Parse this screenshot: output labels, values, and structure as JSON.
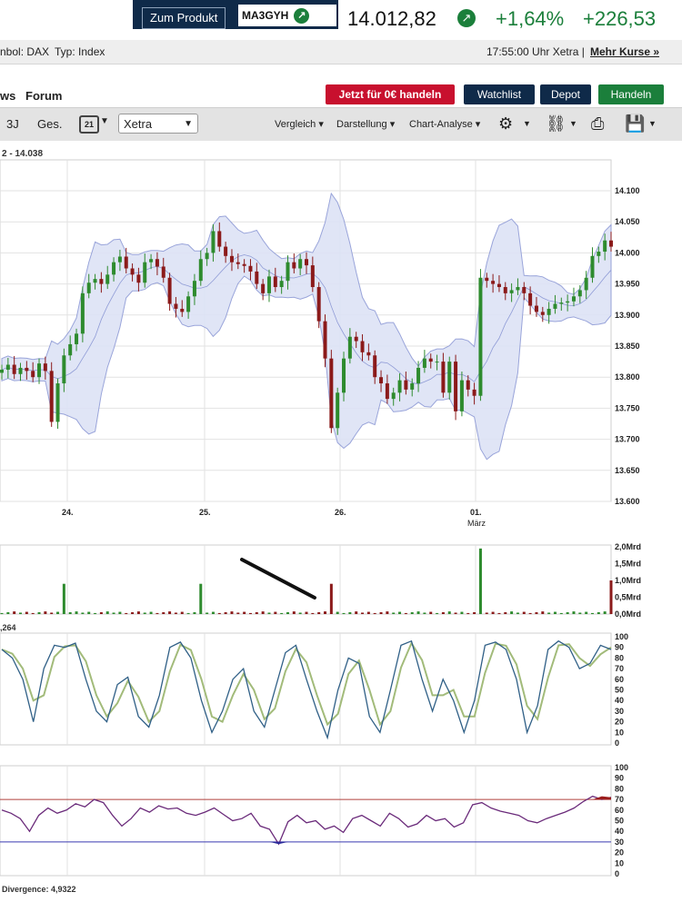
{
  "header": {
    "product_button": "Zum Produkt",
    "wkn": "MA3GYH",
    "arrow_icon": "arrow-up-right-icon",
    "price": "14.012,82",
    "change_pct": "+1,64%",
    "change_abs": "+226,53"
  },
  "infobar": {
    "symbol": "nbol: DAX",
    "type": "Typ: Index",
    "time": "17:55:00 Uhr Xetra |",
    "more": "Mehr Kurse »"
  },
  "nav": {
    "news": "ws",
    "forum": "Forum",
    "trade_button": "Jetzt für 0€ handeln",
    "watchlist": "Watchlist",
    "depot": "Depot",
    "handeln": "Handeln"
  },
  "toolbar": {
    "range_3j": "3J",
    "range_ges": "Ges.",
    "calendar_day": "21",
    "exchange": "Xetra",
    "vergleich": "Vergleich",
    "darstellung": "Darstellung",
    "analyse": "Chart-Analyse",
    "icons": [
      "gear-icon",
      "network-icon",
      "printer-icon",
      "save-icon"
    ]
  },
  "colors": {
    "up": "#2e8b2e",
    "down": "#8b1a1a",
    "band_fill": "#dde3f6",
    "band_line": "#8f9bd6",
    "grid": "#e2e2e2",
    "rsi_line": "#6a2a7a",
    "stoch_k": "#2f5f86",
    "stoch_d": "#a2bb7a"
  },
  "chart_data": [
    {
      "type": "candlestick",
      "range_label": "2 - 14.038",
      "x_ticks": [
        "24.",
        "25.",
        "26.",
        "01."
      ],
      "x_month_label": "März",
      "y_ticks": [
        "14.100",
        "14.050",
        "14.000",
        "13.950",
        "13.900",
        "13.850",
        "13.800",
        "13.750",
        "13.700",
        "13.650",
        "13.600"
      ],
      "ylim": [
        13600,
        14100
      ],
      "overlay": "bollinger-bands",
      "closes": [
        13812,
        13820,
        13805,
        13815,
        13810,
        13800,
        13822,
        13810,
        13728,
        13790,
        13835,
        13853,
        13870,
        13935,
        13952,
        13958,
        13950,
        13965,
        13985,
        13994,
        13975,
        13965,
        13952,
        13985,
        13990,
        13978,
        13960,
        13918,
        13910,
        13905,
        13930,
        13955,
        13990,
        14000,
        14035,
        14010,
        13995,
        13985,
        13982,
        13979,
        13970,
        13950,
        13935,
        13962,
        13945,
        13955,
        13985,
        13975,
        13990,
        13980,
        13945,
        13890,
        13830,
        13718,
        13775,
        13830,
        13865,
        13858,
        13840,
        13835,
        13800,
        13790,
        13765,
        13775,
        13795,
        13780,
        13790,
        13815,
        13830,
        13825,
        13825,
        13775,
        13825,
        13745,
        13795,
        13780,
        13770,
        13960,
        13955,
        13950,
        13945,
        13935,
        13940,
        13945,
        13935,
        13915,
        13905,
        13900,
        13910,
        13918,
        13920,
        13922,
        13930,
        13940,
        13960,
        13995,
        14002,
        14020,
        14010
      ]
    },
    {
      "type": "bar",
      "name": "volume",
      "y_ticks": [
        "2,0Mrd",
        "1,5Mrd",
        "1,0Mrd",
        "0,5Mrd",
        "0,0Mrd"
      ],
      "ylim": [
        0,
        2.0
      ],
      "spikes": [
        {
          "x_index": 10,
          "value": 0.9
        },
        {
          "x_index": 32,
          "value": 0.9
        },
        {
          "x_index": 53,
          "value": 0.9
        },
        {
          "x_index": 77,
          "value": 1.95
        },
        {
          "x_index": 98,
          "value": 1.0
        }
      ]
    },
    {
      "type": "line",
      "name": "stochastic",
      "value_label": ",264",
      "y_ticks": [
        "100",
        "90",
        "80",
        "70",
        "60",
        "50",
        "40",
        "30",
        "20",
        "10",
        "0"
      ],
      "ylim": [
        0,
        100
      ],
      "k": [
        88,
        80,
        60,
        20,
        70,
        92,
        90,
        94,
        60,
        30,
        20,
        55,
        62,
        25,
        15,
        45,
        90,
        95,
        80,
        40,
        10,
        30,
        60,
        70,
        30,
        15,
        50,
        85,
        92,
        60,
        30,
        5,
        50,
        80,
        75,
        25,
        10,
        50,
        92,
        96,
        60,
        30,
        60,
        40,
        10,
        40,
        92,
        95,
        88,
        60,
        10,
        35,
        88,
        96,
        90,
        70,
        75,
        92,
        88
      ]
    },
    {
      "type": "line",
      "name": "rsi",
      "y_ticks": [
        "100",
        "90",
        "80",
        "70",
        "60",
        "50",
        "40",
        "30",
        "20",
        "10",
        "0"
      ],
      "ylim": [
        0,
        100
      ],
      "levels": [
        70,
        30
      ],
      "footer_label": "Divergence: 4,9322",
      "values": [
        60,
        57,
        52,
        40,
        55,
        62,
        57,
        60,
        66,
        63,
        70,
        67,
        55,
        45,
        52,
        62,
        58,
        64,
        61,
        62,
        57,
        55,
        58,
        62,
        56,
        50,
        52,
        57,
        45,
        42,
        28,
        49,
        55,
        48,
        50,
        42,
        45,
        39,
        52,
        55,
        50,
        45,
        57,
        52,
        44,
        47,
        55,
        50,
        52,
        44,
        48,
        65,
        67,
        62,
        59,
        57,
        55,
        50,
        48,
        52,
        55,
        58,
        62,
        68,
        73,
        70,
        72
      ]
    }
  ]
}
